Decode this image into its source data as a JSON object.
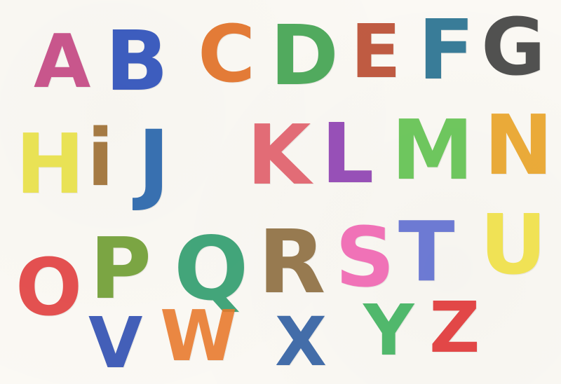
{
  "letters": [
    {
      "char": "A",
      "color": "#c2407f"
    },
    {
      "char": "B",
      "color": "#2448b8"
    },
    {
      "char": "C",
      "color": "#e06b1e"
    },
    {
      "char": "D",
      "color": "#3aa04a"
    },
    {
      "char": "E",
      "color": "#b8462a"
    },
    {
      "char": "F",
      "color": "#1f6b8c"
    },
    {
      "char": "G",
      "color": "#3a3a3a"
    },
    {
      "char": "H",
      "color": "#e8e040"
    },
    {
      "char": "i",
      "color": "#9a6a2c"
    },
    {
      "char": "J",
      "color": "#1e5ea8"
    },
    {
      "char": "K",
      "color": "#e05a66"
    },
    {
      "char": "L",
      "color": "#8a3ab0"
    },
    {
      "char": "M",
      "color": "#5cc04a"
    },
    {
      "char": "N",
      "color": "#e8a020"
    },
    {
      "char": "O",
      "color": "#e03a3a"
    },
    {
      "char": "P",
      "color": "#6a9a2c"
    },
    {
      "char": "Q",
      "color": "#2a9a6a"
    },
    {
      "char": "R",
      "color": "#8a6a3a"
    },
    {
      "char": "S",
      "color": "#f060b0"
    },
    {
      "char": "T",
      "color": "#5a6ad0"
    },
    {
      "char": "U",
      "color": "#f0e040"
    },
    {
      "char": "V",
      "color": "#2a4ab0"
    },
    {
      "char": "W",
      "color": "#e8782a"
    },
    {
      "char": "X",
      "color": "#2a5aa0"
    },
    {
      "char": "Y",
      "color": "#3ab05a"
    },
    {
      "char": "Z",
      "color": "#e03030"
    }
  ]
}
